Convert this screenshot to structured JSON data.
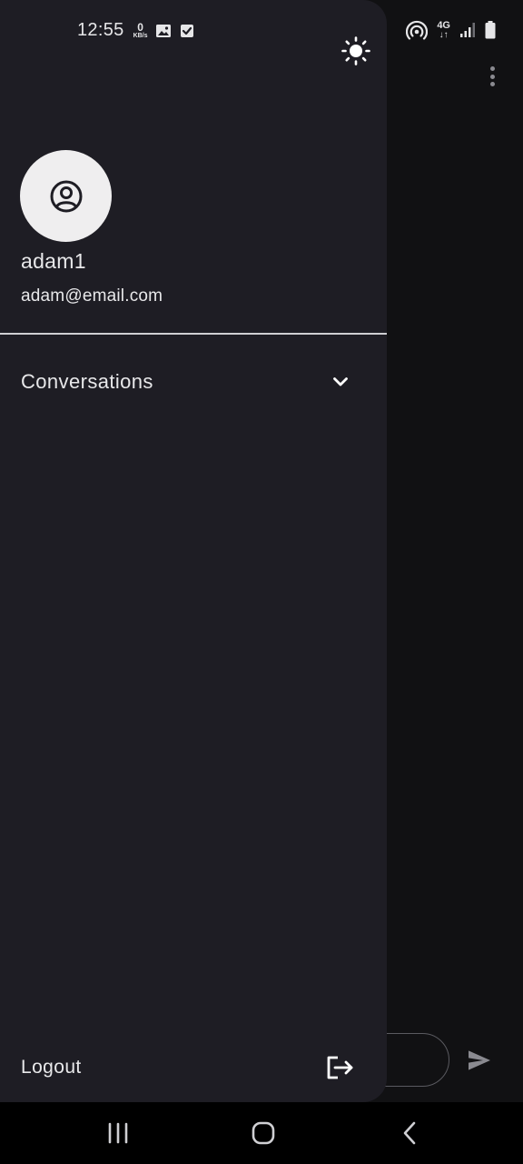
{
  "status_bar": {
    "time": "12:55",
    "net_speed_value": "0",
    "net_speed_unit": "KB/s",
    "network_label": "4G",
    "icons": [
      "image-icon",
      "checkbox-icon",
      "hotspot-icon",
      "signal-icon",
      "battery-icon"
    ]
  },
  "drawer": {
    "theme_toggle_icon": "sun-icon",
    "user": {
      "avatar_icon": "user-circle-icon",
      "username": "adam1",
      "email": "adam@email.com"
    },
    "conversations": {
      "label": "Conversations",
      "icon": "chevron-down-icon"
    },
    "logout": {
      "label": "Logout",
      "icon": "logout-icon"
    }
  },
  "background_app": {
    "menu_icon": "more-vert-icon",
    "send_icon": "send-icon"
  },
  "nav_bar": {
    "buttons": [
      "recents-icon",
      "home-icon",
      "back-icon"
    ]
  },
  "colors": {
    "drawer_bg": "#1e1d24",
    "app_bg": "#111113",
    "text": "#e8e8ea",
    "avatar_bg": "#efeeef"
  }
}
